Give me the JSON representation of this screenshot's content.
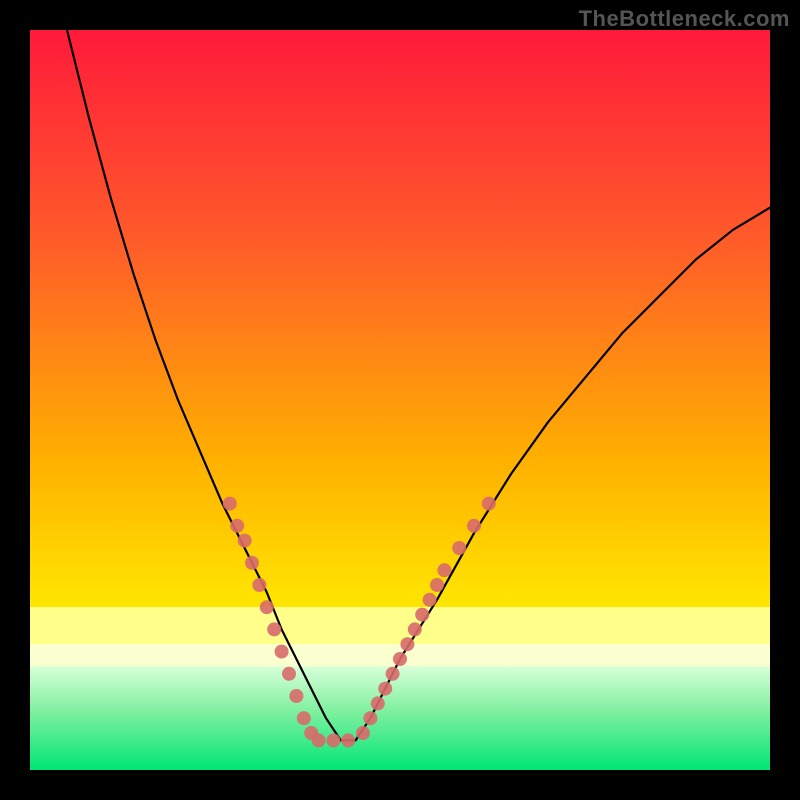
{
  "watermark": "TheBottleneck.com",
  "chart_data": {
    "type": "line",
    "title": "",
    "xlabel": "",
    "ylabel": "",
    "xlim": [
      0,
      100
    ],
    "ylim": [
      0,
      100
    ],
    "background": {
      "top_color": "#ff1a3a",
      "mid_color": "#ffe600",
      "bottom_color": "#00e676",
      "bands": [
        {
          "from_y": 0,
          "to_y": 78,
          "style": "gradient",
          "stops": [
            "#ff1a3a",
            "#ff6a2a",
            "#ffe600"
          ]
        },
        {
          "from_y": 78,
          "to_y": 83,
          "style": "solid",
          "color": "#ffff8a"
        },
        {
          "from_y": 83,
          "to_y": 86,
          "style": "solid",
          "color": "#faffd0"
        },
        {
          "from_y": 86,
          "to_y": 100,
          "style": "gradient",
          "stops": [
            "#d8ffd8",
            "#00e676"
          ]
        }
      ]
    },
    "series": [
      {
        "name": "bottleneck-curve",
        "color": "#000000",
        "x": [
          5,
          8,
          11,
          14,
          17,
          20,
          23,
          26,
          29,
          32,
          34,
          36,
          38,
          40,
          42,
          44,
          46,
          48,
          50,
          55,
          60,
          65,
          70,
          75,
          80,
          85,
          90,
          95,
          100
        ],
        "y": [
          0,
          12,
          23,
          33,
          42,
          50,
          57,
          64,
          70,
          76,
          81,
          85,
          89,
          93,
          96,
          96,
          93,
          89,
          85,
          77,
          68,
          60,
          53,
          47,
          41,
          36,
          31,
          27,
          24
        ]
      }
    ],
    "markers": {
      "name": "dot-cluster",
      "color": "#d86a6a",
      "radius": 7,
      "points": [
        {
          "x": 27,
          "y": 64
        },
        {
          "x": 28,
          "y": 67
        },
        {
          "x": 29,
          "y": 69
        },
        {
          "x": 30,
          "y": 72
        },
        {
          "x": 31,
          "y": 75
        },
        {
          "x": 32,
          "y": 78
        },
        {
          "x": 33,
          "y": 81
        },
        {
          "x": 34,
          "y": 84
        },
        {
          "x": 35,
          "y": 87
        },
        {
          "x": 36,
          "y": 90
        },
        {
          "x": 37,
          "y": 93
        },
        {
          "x": 38,
          "y": 95
        },
        {
          "x": 39,
          "y": 96
        },
        {
          "x": 41,
          "y": 96
        },
        {
          "x": 43,
          "y": 96
        },
        {
          "x": 45,
          "y": 95
        },
        {
          "x": 46,
          "y": 93
        },
        {
          "x": 47,
          "y": 91
        },
        {
          "x": 48,
          "y": 89
        },
        {
          "x": 49,
          "y": 87
        },
        {
          "x": 50,
          "y": 85
        },
        {
          "x": 51,
          "y": 83
        },
        {
          "x": 52,
          "y": 81
        },
        {
          "x": 53,
          "y": 79
        },
        {
          "x": 54,
          "y": 77
        },
        {
          "x": 55,
          "y": 75
        },
        {
          "x": 56,
          "y": 73
        },
        {
          "x": 58,
          "y": 70
        },
        {
          "x": 60,
          "y": 67
        },
        {
          "x": 62,
          "y": 64
        }
      ]
    }
  }
}
